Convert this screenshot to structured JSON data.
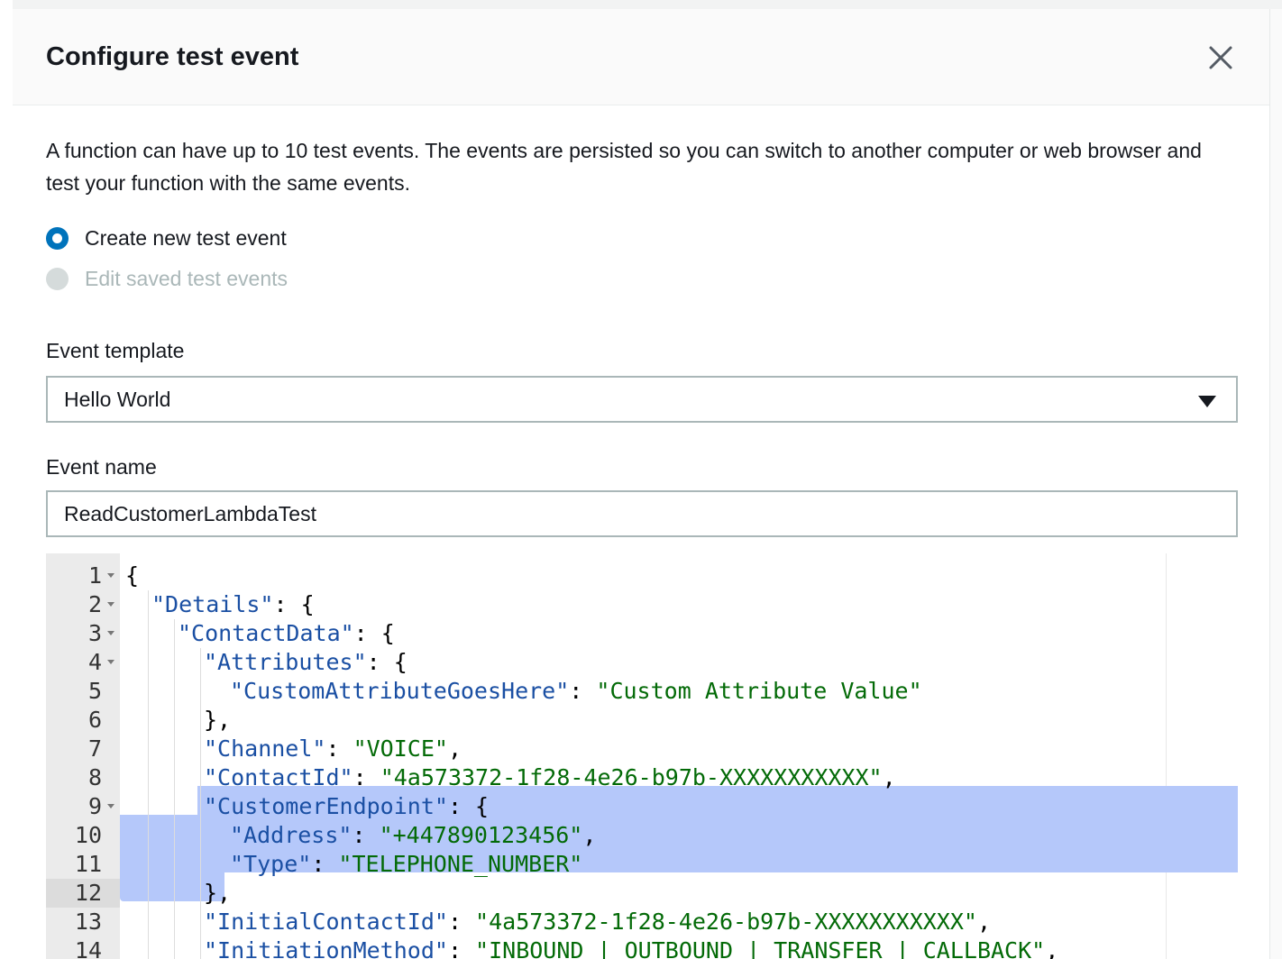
{
  "dialog": {
    "title": "Configure test event",
    "description": "A function can have up to 10 test events. The events are persisted so you can switch to another computer or web browser and test your function with the same events."
  },
  "options": {
    "create_label": "Create new test event",
    "edit_label": "Edit saved test events",
    "selected": "create"
  },
  "event_template": {
    "label": "Event template",
    "value": "Hello World"
  },
  "event_name": {
    "label": "Event name",
    "value": "ReadCustomerLambdaTest"
  },
  "editor": {
    "active_line": 12,
    "lines": [
      {
        "num": "1",
        "fold": true,
        "indent": 0,
        "tokens": [
          {
            "t": "p",
            "s": "{"
          }
        ]
      },
      {
        "num": "2",
        "fold": true,
        "indent": 1,
        "tokens": [
          {
            "t": "k",
            "s": "\"Details\""
          },
          {
            "t": "p",
            "s": ": {"
          }
        ]
      },
      {
        "num": "3",
        "fold": true,
        "indent": 2,
        "tokens": [
          {
            "t": "k",
            "s": "\"ContactData\""
          },
          {
            "t": "p",
            "s": ": {"
          }
        ]
      },
      {
        "num": "4",
        "fold": true,
        "indent": 3,
        "tokens": [
          {
            "t": "k",
            "s": "\"Attributes\""
          },
          {
            "t": "p",
            "s": ": {"
          }
        ]
      },
      {
        "num": "5",
        "fold": false,
        "indent": 4,
        "tokens": [
          {
            "t": "k",
            "s": "\"CustomAttributeGoesHere\""
          },
          {
            "t": "p",
            "s": ": "
          },
          {
            "t": "v",
            "s": "\"Custom Attribute Value\""
          }
        ]
      },
      {
        "num": "6",
        "fold": false,
        "indent": 3,
        "tokens": [
          {
            "t": "p",
            "s": "},"
          }
        ]
      },
      {
        "num": "7",
        "fold": false,
        "indent": 3,
        "tokens": [
          {
            "t": "k",
            "s": "\"Channel\""
          },
          {
            "t": "p",
            "s": ": "
          },
          {
            "t": "v",
            "s": "\"VOICE\""
          },
          {
            "t": "p",
            "s": ","
          }
        ]
      },
      {
        "num": "8",
        "fold": false,
        "indent": 3,
        "tokens": [
          {
            "t": "k",
            "s": "\"ContactId\""
          },
          {
            "t": "p",
            "s": ": "
          },
          {
            "t": "v",
            "s": "\"4a573372-1f28-4e26-b97b-XXXXXXXXXXX\""
          },
          {
            "t": "p",
            "s": ","
          }
        ]
      },
      {
        "num": "9",
        "fold": true,
        "indent": 3,
        "tokens": [
          {
            "t": "k",
            "s": "\"CustomerEndpoint\""
          },
          {
            "t": "p",
            "s": ": {"
          }
        ]
      },
      {
        "num": "10",
        "fold": false,
        "indent": 4,
        "tokens": [
          {
            "t": "k",
            "s": "\"Address\""
          },
          {
            "t": "p",
            "s": ": "
          },
          {
            "t": "v",
            "s": "\"+447890123456\""
          },
          {
            "t": "p",
            "s": ","
          }
        ]
      },
      {
        "num": "11",
        "fold": false,
        "indent": 4,
        "tokens": [
          {
            "t": "k",
            "s": "\"Type\""
          },
          {
            "t": "p",
            "s": ": "
          },
          {
            "t": "v",
            "s": "\"TELEPHONE_NUMBER\""
          }
        ]
      },
      {
        "num": "12",
        "fold": false,
        "indent": 3,
        "tokens": [
          {
            "t": "p",
            "s": "},"
          }
        ]
      },
      {
        "num": "13",
        "fold": false,
        "indent": 3,
        "tokens": [
          {
            "t": "k",
            "s": "\"InitialContactId\""
          },
          {
            "t": "p",
            "s": ": "
          },
          {
            "t": "v",
            "s": "\"4a573372-1f28-4e26-b97b-XXXXXXXXXXX\""
          },
          {
            "t": "p",
            "s": ","
          }
        ]
      },
      {
        "num": "14",
        "fold": false,
        "indent": 3,
        "tokens": [
          {
            "t": "k",
            "s": "\"InitiationMethod\""
          },
          {
            "t": "p",
            "s": ": "
          },
          {
            "t": "v",
            "s": "\"INBOUND | OUTBOUND | TRANSFER | CALLBACK\""
          },
          {
            "t": "p",
            "s": ","
          }
        ]
      }
    ]
  },
  "colors": {
    "accent": "#0073bb",
    "json_key": "#1a4fa3",
    "json_string": "#036a07",
    "selection": "#b5c8fa"
  },
  "icons": {
    "close": "close-icon",
    "dropdown": "caret-down-icon"
  }
}
